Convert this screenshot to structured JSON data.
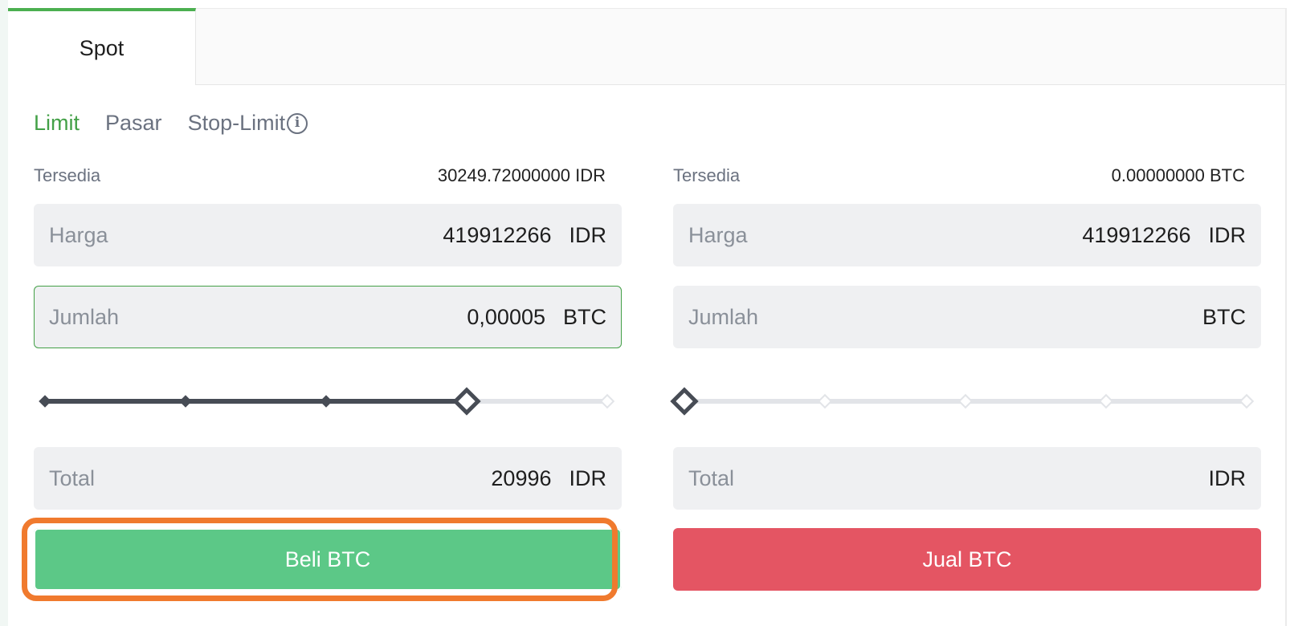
{
  "tabs": [
    {
      "label": "Spot",
      "active": true
    }
  ],
  "order_types": [
    {
      "label": "Limit",
      "active": true
    },
    {
      "label": "Pasar",
      "active": false
    },
    {
      "label": "Stop-Limit",
      "active": false,
      "has_info_icon": true
    }
  ],
  "info_icon_glyph": "i",
  "buy": {
    "available_label": "Tersedia",
    "available_value": "30249.72000000 IDR",
    "price": {
      "label": "Harga",
      "value": "419912266",
      "unit": "IDR"
    },
    "amount": {
      "label": "Jumlah",
      "value": "0,00005",
      "unit": "BTC"
    },
    "slider_level_percent": 75,
    "total": {
      "label": "Total",
      "value": "20996",
      "unit": "IDR"
    },
    "button_label": "Beli BTC"
  },
  "sell": {
    "available_label": "Tersedia",
    "available_value": "0.00000000 BTC",
    "price": {
      "label": "Harga",
      "value": "419912266",
      "unit": "IDR"
    },
    "amount": {
      "label": "Jumlah",
      "value": "",
      "unit": "BTC"
    },
    "slider_level_percent": 0,
    "total": {
      "label": "Total",
      "value": "",
      "unit": "IDR"
    },
    "button_label": "Jual BTC"
  },
  "colors": {
    "accent_green": "#43a047",
    "buy_button": "#5cc887",
    "sell_button": "#e45563",
    "highlight": "#f07a2e",
    "slider_active": "#474c55",
    "slider_inactive": "#e2e4e8"
  }
}
